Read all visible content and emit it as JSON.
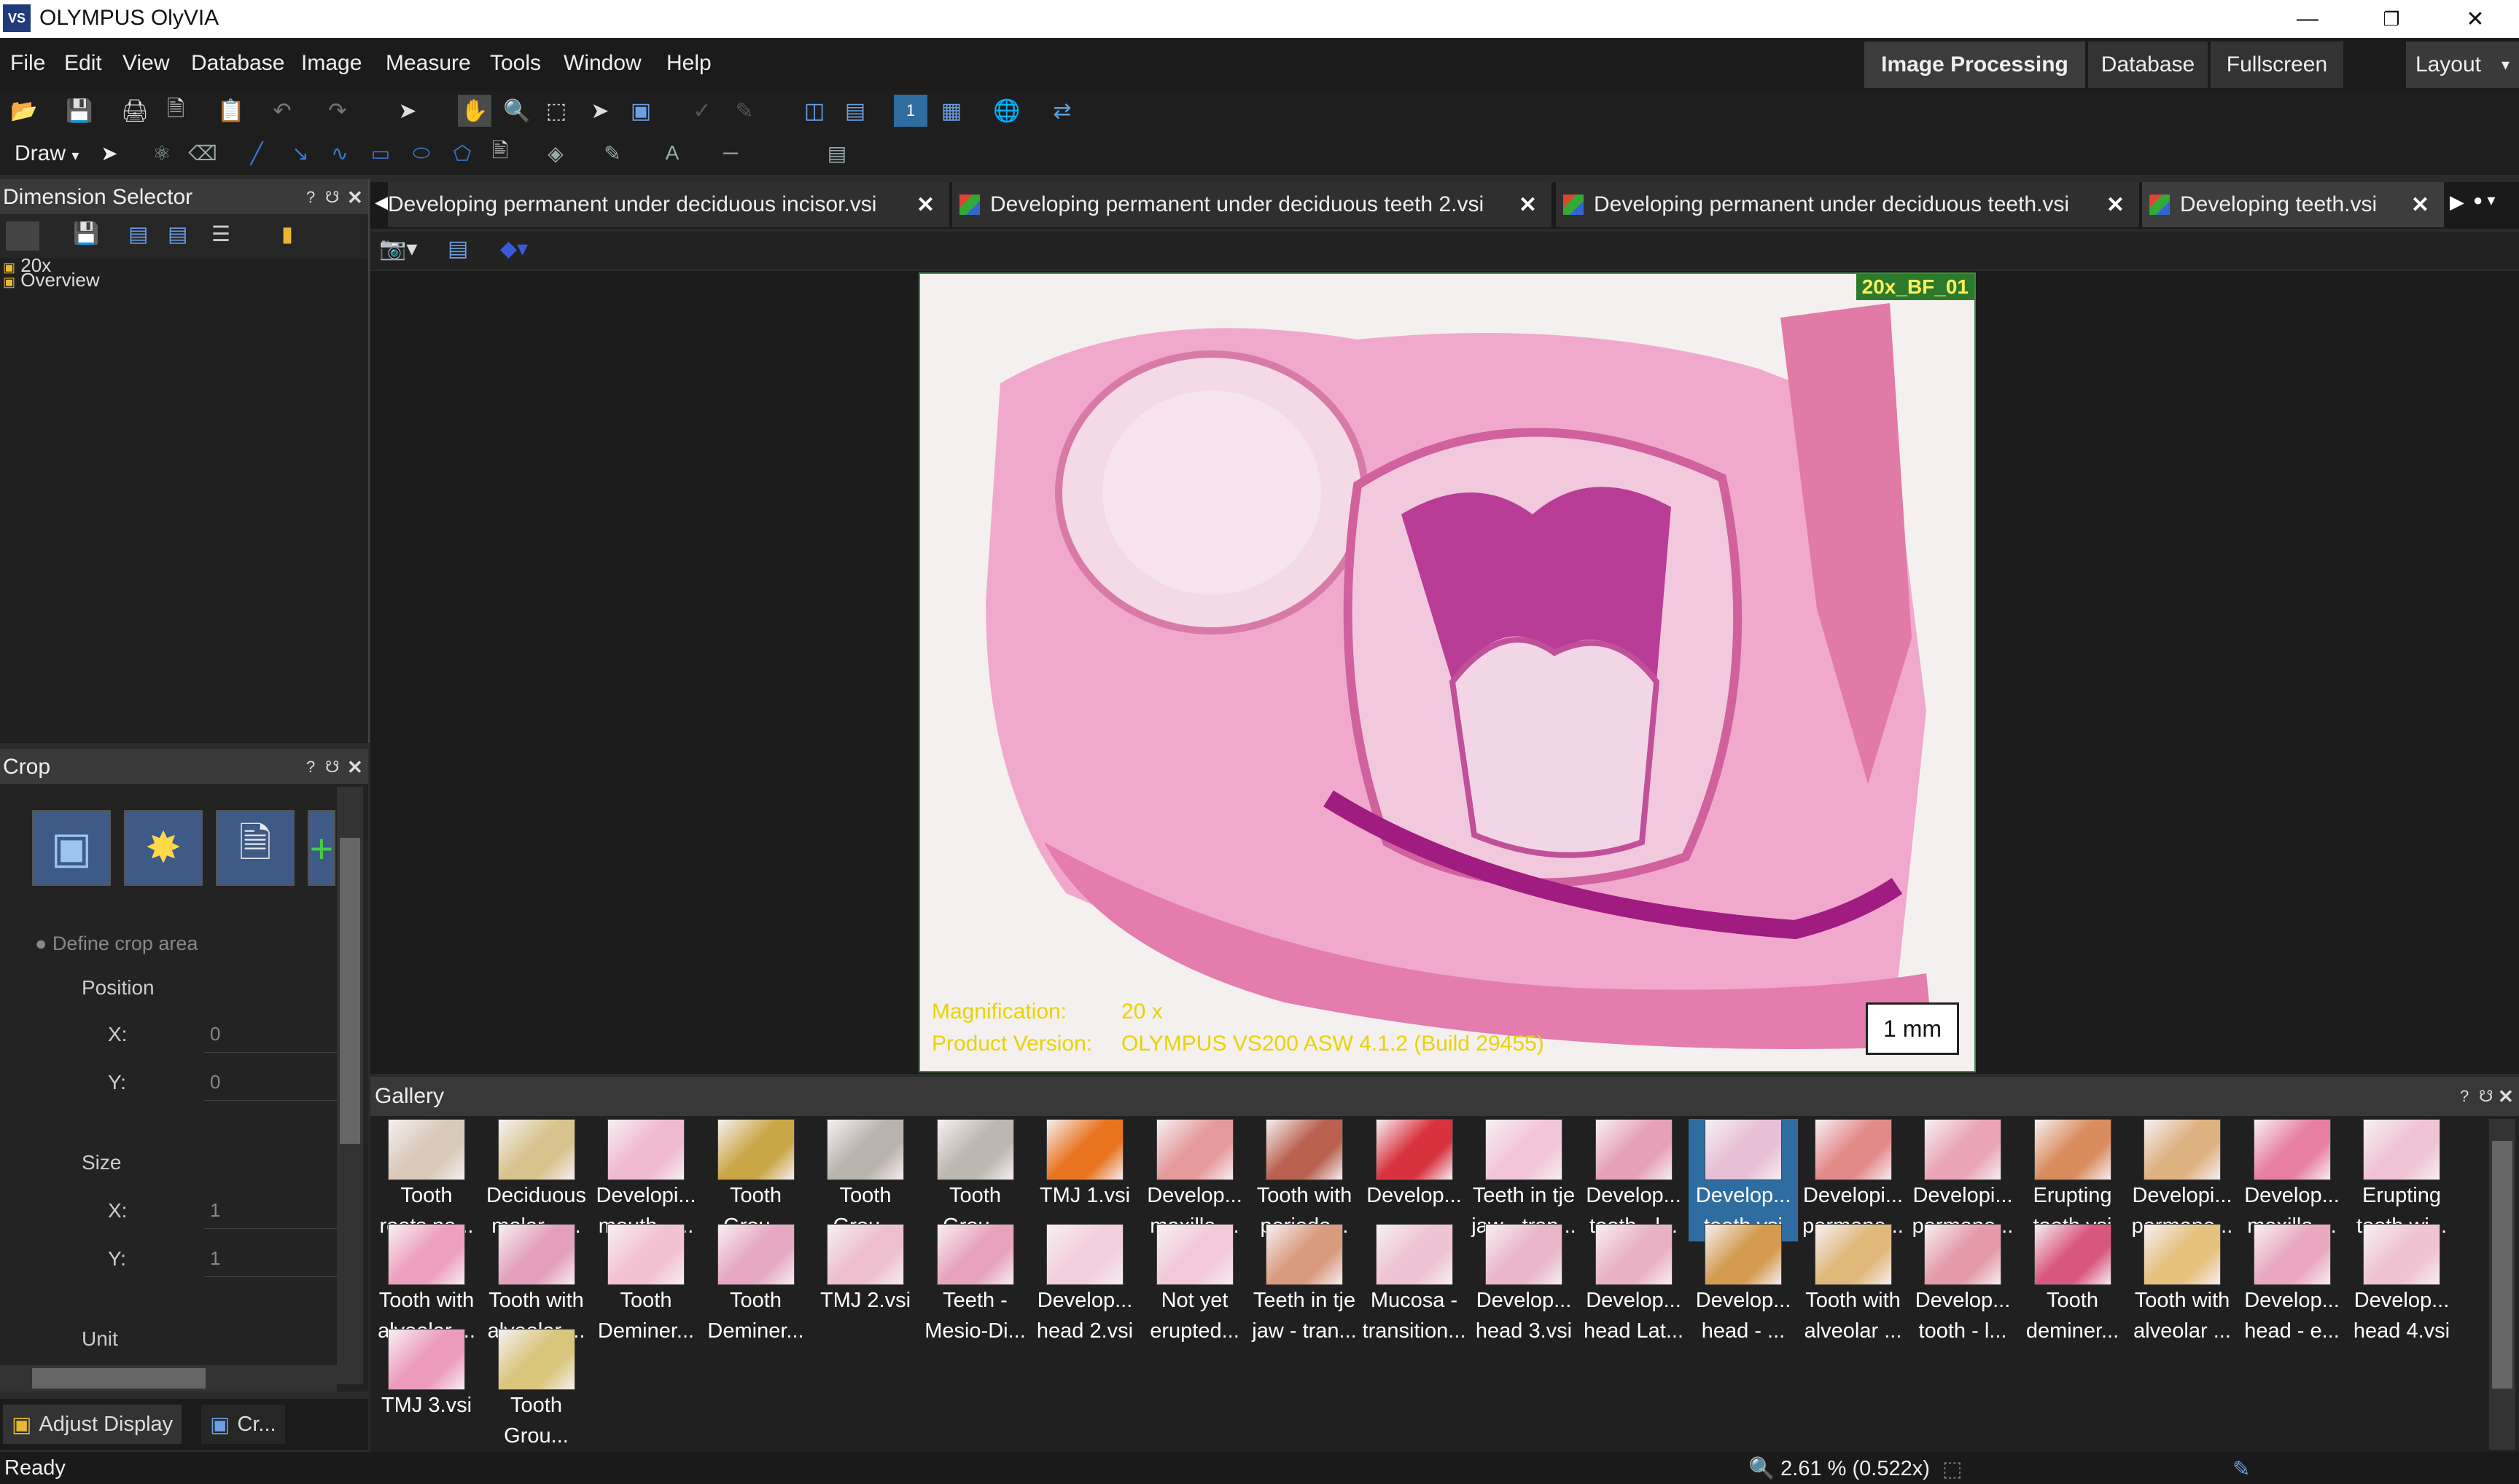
{
  "window": {
    "title": "OLYMPUS OlyVIA",
    "logo": "VS",
    "controls": [
      "minimize-icon",
      "restore-icon",
      "close-icon"
    ]
  },
  "menu": [
    "File",
    "Edit",
    "View",
    "Database",
    "Image",
    "Measure",
    "Tools",
    "Window",
    "Help"
  ],
  "workspace_buttons": {
    "image_processing": "Image Processing",
    "database": "Database",
    "fullscreen": "Fullscreen",
    "layout": "Layout"
  },
  "toolbar2": {
    "draw_label": "Draw"
  },
  "dimension_selector": {
    "title": "Dimension Selector",
    "tree": [
      "20x",
      "Overview"
    ]
  },
  "crop": {
    "title": "Crop",
    "define_crop_area": "Define crop area",
    "position_label": "Position",
    "size_label": "Size",
    "unit_label": "Unit",
    "x_label": "X:",
    "y_label": "Y:",
    "position": {
      "x": "0",
      "y": "0"
    },
    "size": {
      "x": "1",
      "y": "1"
    }
  },
  "tabs": [
    {
      "label": "Developing permanent under deciduous incisor.vsi",
      "active": false
    },
    {
      "label": "Developing permanent under deciduous teeth 2.vsi",
      "active": false
    },
    {
      "label": "Developing permanent under deciduous teeth.vsi",
      "active": false
    },
    {
      "label": "Developing teeth.vsi",
      "active": true
    }
  ],
  "viewer": {
    "layer_label": "20x_BF_01",
    "magnification_label": "Magnification:",
    "magnification_value": "20 x",
    "product_version_label": "Product Version:",
    "product_version_value": "OLYMPUS VS200 ASW 4.1.2 (Build 29455)",
    "scale_bar": "1 mm"
  },
  "gallery": {
    "title": "Gallery",
    "rows": [
      [
        {
          "l1": "Tooth",
          "l2": "roots ne...",
          "color": "#d9c9b8"
        },
        {
          "l1": "Deciduous",
          "l2": "molar - ...",
          "color": "#d8c48e"
        },
        {
          "l1": "Developi...",
          "l2": "mouth - ...",
          "color": "#efb9cf"
        },
        {
          "l1": "Tooth",
          "l2": "Grou...",
          "color": "#c9a646"
        },
        {
          "l1": "Tooth",
          "l2": "Grou...",
          "color": "#b9b3ad"
        },
        {
          "l1": "Tooth",
          "l2": "Grou...",
          "color": "#bcb7b0"
        },
        {
          "l1": "TMJ 1.vsi",
          "l2": "",
          "color": "#e8741f"
        },
        {
          "l1": "Develop...",
          "l2": "maxilla ...",
          "color": "#e59a9a"
        },
        {
          "l1": "Tooth with",
          "l2": "periodo...",
          "color": "#b9604e"
        },
        {
          "l1": "Develop...",
          "l2": "",
          "color": "#d8323e"
        },
        {
          "l1": "Teeth in tje",
          "l2": "jaw - tran...",
          "color": "#f2c6d8"
        },
        {
          "l1": "Develop...",
          "l2": "tooth - l...",
          "color": "#e6a0b8"
        },
        {
          "l1": "Develop...",
          "l2": "teeth.vsi",
          "color": "#e7bfd6",
          "selected": true
        },
        {
          "l1": "Developi...",
          "l2": "permane...",
          "color": "#e28a8a"
        },
        {
          "l1": "Developi...",
          "l2": "permane...",
          "color": "#eaa4b6"
        },
        {
          "l1": "Erupting",
          "l2": "tooth.vsi",
          "color": "#d98c5e"
        },
        {
          "l1": "Developi...",
          "l2": "permane...",
          "color": "#ddb180"
        },
        {
          "l1": "Develop...",
          "l2": "maxilla ...",
          "color": "#e77fa2"
        },
        {
          "l1": "Erupting",
          "l2": "tooth wi...",
          "color": "#efc4d5"
        }
      ],
      [
        {
          "l1": "Tooth with",
          "l2": "alveolar ...",
          "color": "#ee9fbf"
        },
        {
          "l1": "Tooth with",
          "l2": "alveolar ...",
          "color": "#e39fbb"
        },
        {
          "l1": "Tooth",
          "l2": "Deminer...",
          "color": "#f3c2d2"
        },
        {
          "l1": "Tooth",
          "l2": "Deminer...",
          "color": "#e6a7c2"
        },
        {
          "l1": "TMJ 2.vsi",
          "l2": "",
          "color": "#eebfcf"
        },
        {
          "l1": "Teeth -",
          "l2": "Mesio-Di...",
          "color": "#e8a3bc"
        },
        {
          "l1": "Develop...",
          "l2": "head 2.vsi",
          "color": "#f2cfdd"
        },
        {
          "l1": "Not yet",
          "l2": "erupted...",
          "color": "#f1c9d9"
        },
        {
          "l1": "Teeth in tje",
          "l2": "jaw - tran...",
          "color": "#d99a7e"
        },
        {
          "l1": "Mucosa -",
          "l2": "transition...",
          "color": "#eec3d3"
        },
        {
          "l1": "Develop...",
          "l2": "head 3.vsi",
          "color": "#e9b5c9"
        },
        {
          "l1": "Develop...",
          "l2": "head Lat...",
          "color": "#eab1c5"
        },
        {
          "l1": "Develop...",
          "l2": "head - ...",
          "color": "#d49b4e"
        },
        {
          "l1": "Tooth with",
          "l2": "alveolar ...",
          "color": "#e0b87b"
        },
        {
          "l1": "Develop...",
          "l2": "tooth - l...",
          "color": "#e49aa8"
        },
        {
          "l1": "Tooth",
          "l2": "deminer...",
          "color": "#d8577e"
        },
        {
          "l1": "Tooth with",
          "l2": "alveolar ...",
          "color": "#e6c07d"
        },
        {
          "l1": "Develop...",
          "l2": "head - e...",
          "color": "#e9a8c0"
        },
        {
          "l1": "Develop...",
          "l2": "head 4.vsi",
          "color": "#efc3d2"
        }
      ],
      [
        {
          "l1": "TMJ 3.vsi",
          "l2": "",
          "color": "#ec9bbd"
        },
        {
          "l1": "Tooth",
          "l2": "Grou...",
          "color": "#d8c67c"
        }
      ]
    ]
  },
  "bottom_tabs": {
    "adjust_display": "Adjust Display",
    "crop_short": "Cr..."
  },
  "status": {
    "left": "Ready",
    "zoom": "2.61 % (0.522x)"
  }
}
